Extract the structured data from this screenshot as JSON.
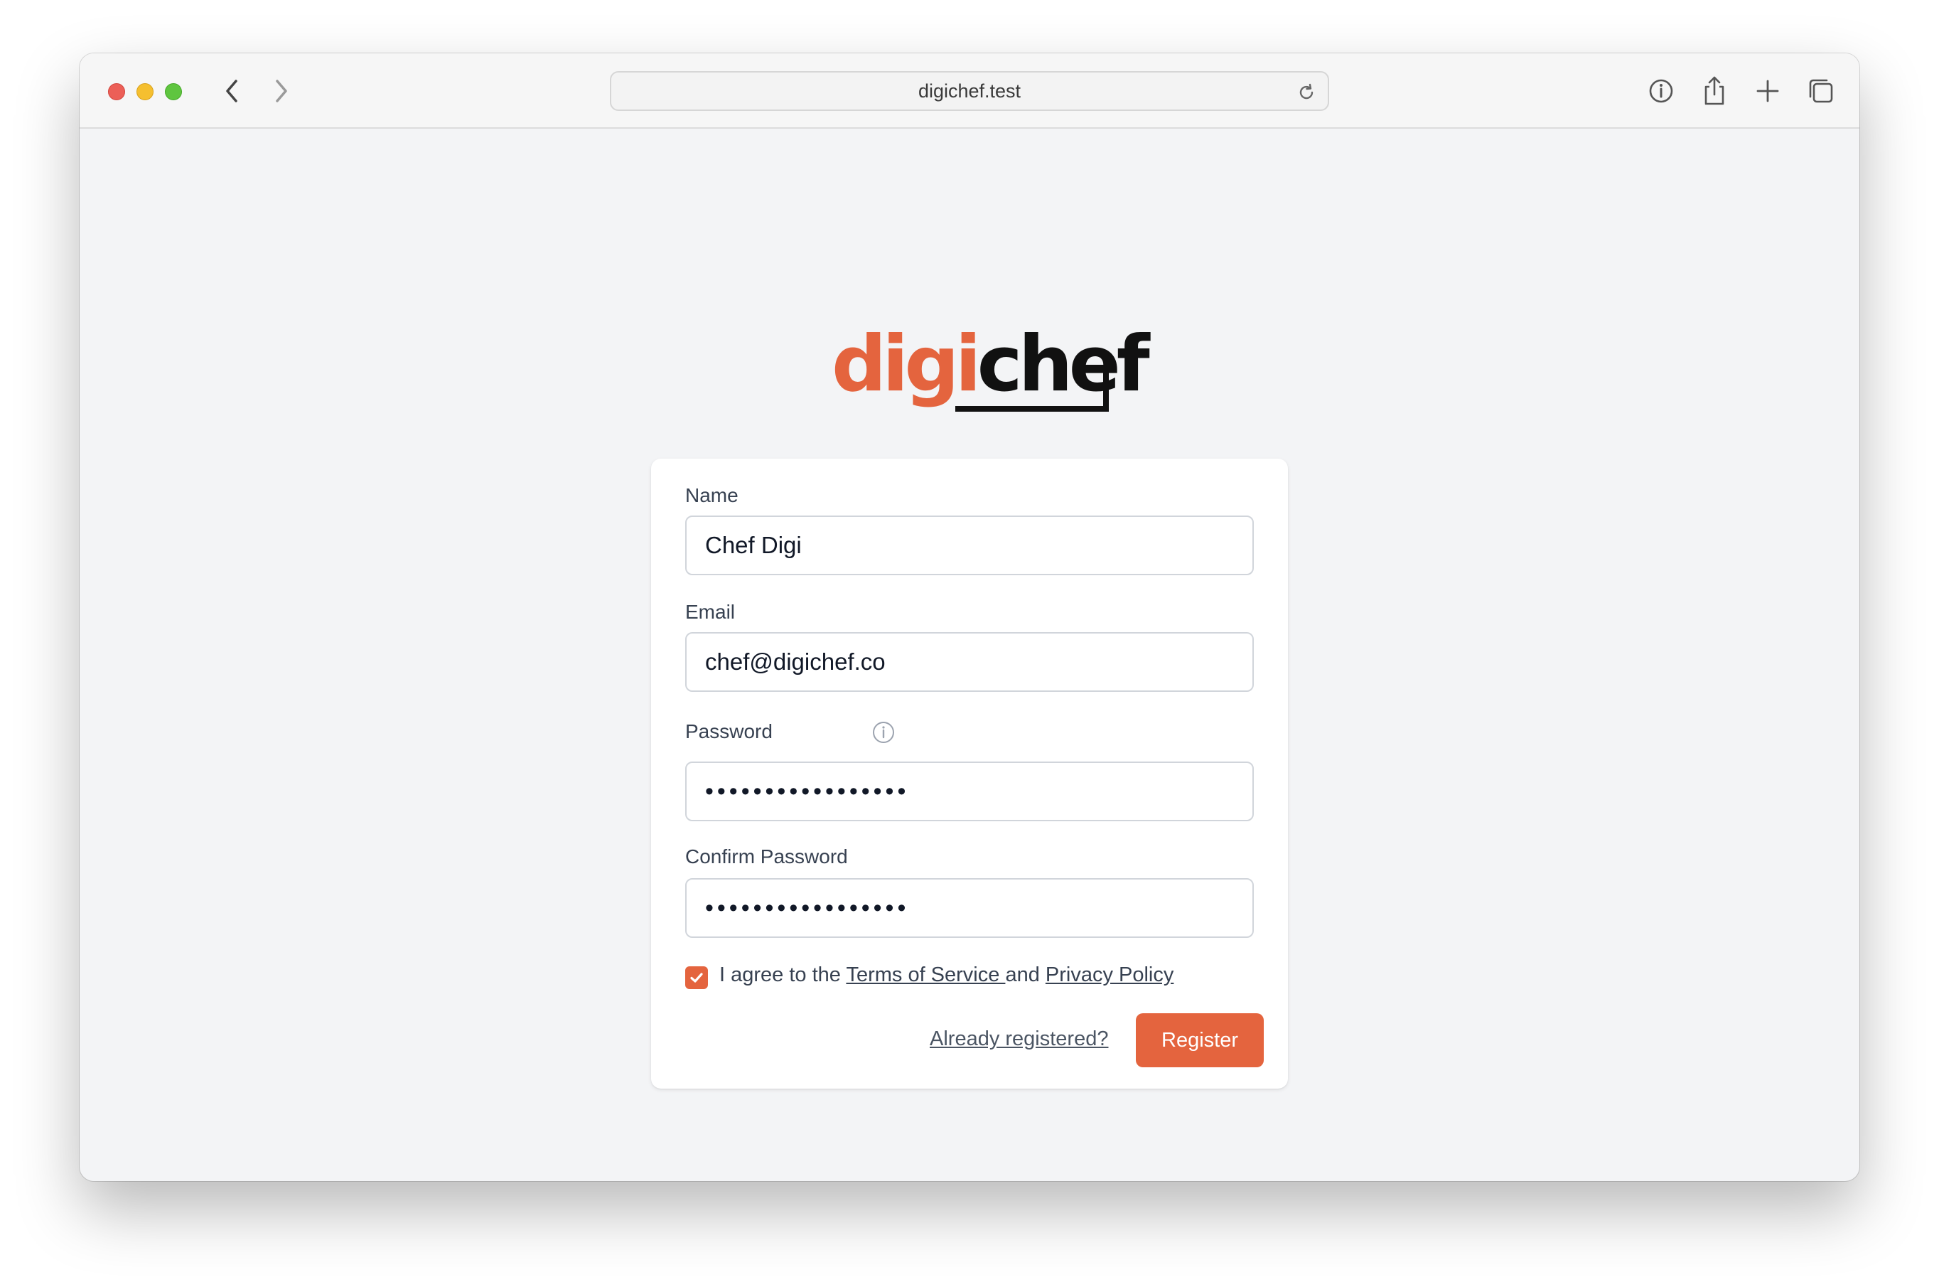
{
  "browser": {
    "url": "digichef.test"
  },
  "logo": {
    "part1": "digi",
    "part2": "chef"
  },
  "form": {
    "name_label": "Name",
    "name_value": "Chef Digi",
    "email_label": "Email",
    "email_value": "chef@digichef.co",
    "password_label": "Password",
    "password_value": "•••••••••••••••••",
    "confirm_label": "Confirm Password",
    "confirm_value": "•••••••••••••••••",
    "agree_prefix": "I agree to the ",
    "terms_link": "Terms of Service ",
    "agree_mid": "and ",
    "privacy_link": "Privacy Policy",
    "agree_checked": true,
    "already_link": "Already registered?",
    "register_button": "Register"
  },
  "colors": {
    "brand": "#e4643e",
    "background": "#f3f4f6"
  }
}
